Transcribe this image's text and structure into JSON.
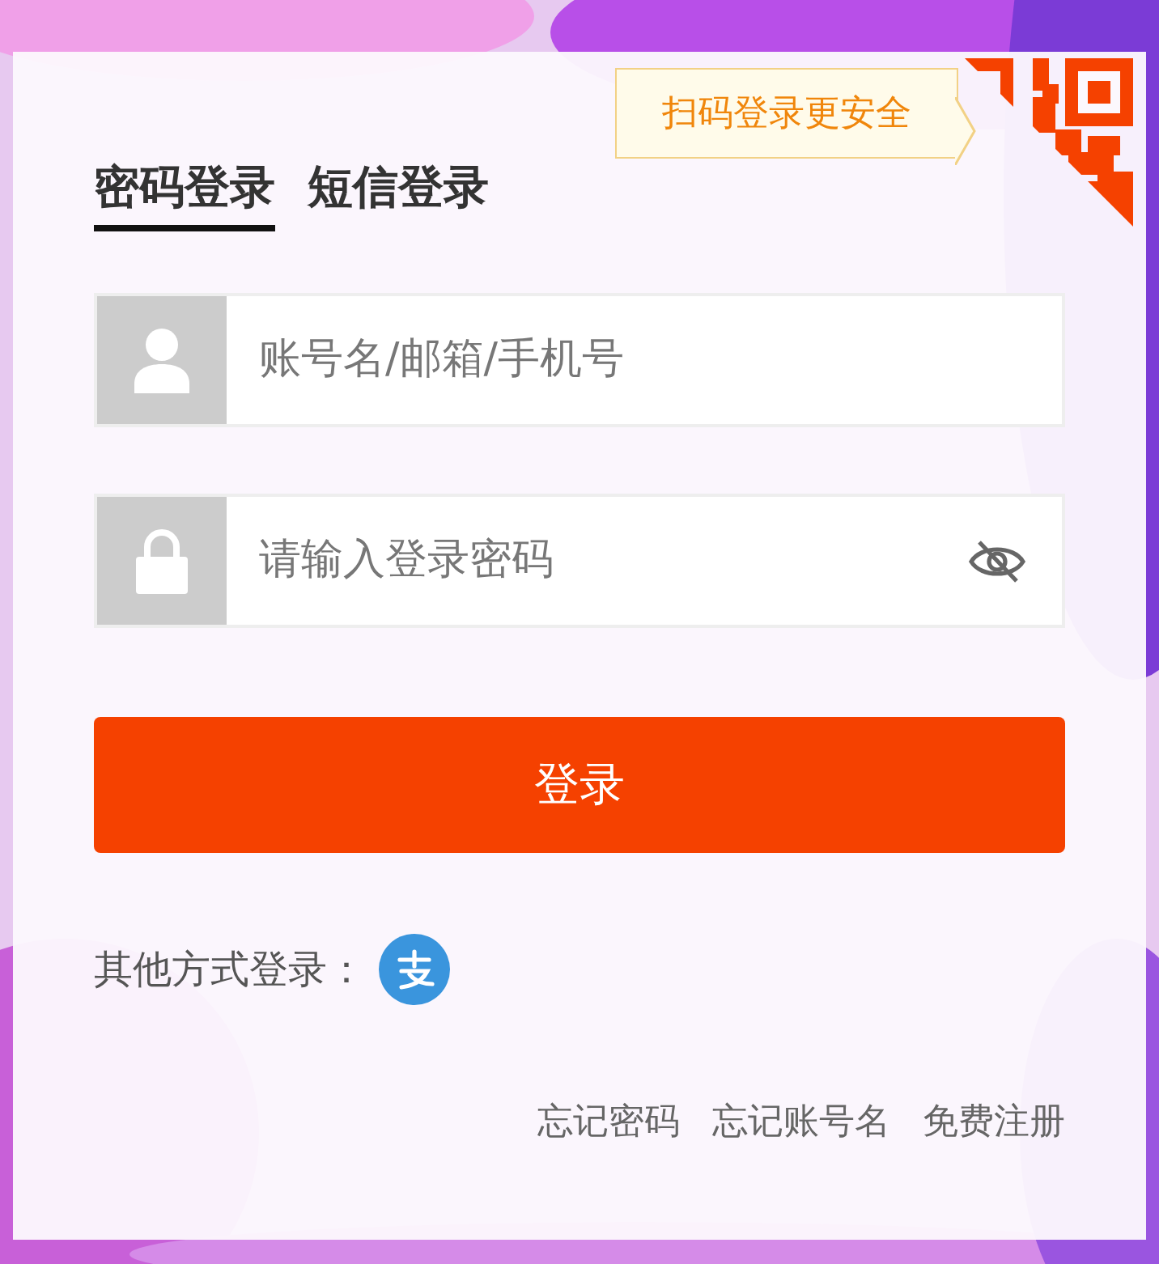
{
  "qr_tip": "扫码登录更安全",
  "tabs": [
    {
      "label": "密码登录",
      "selected": true
    },
    {
      "label": "短信登录",
      "selected": false
    }
  ],
  "fields": [
    {
      "kind": "account",
      "placeholder": "账号名/邮箱/手机号"
    },
    {
      "kind": "password",
      "placeholder": "请输入登录密码",
      "password_visible": false
    }
  ],
  "login_button": "登录",
  "other_login": "其他方式登录：",
  "links": [
    "忘记密码",
    "忘记账号名",
    "免费注册"
  ]
}
